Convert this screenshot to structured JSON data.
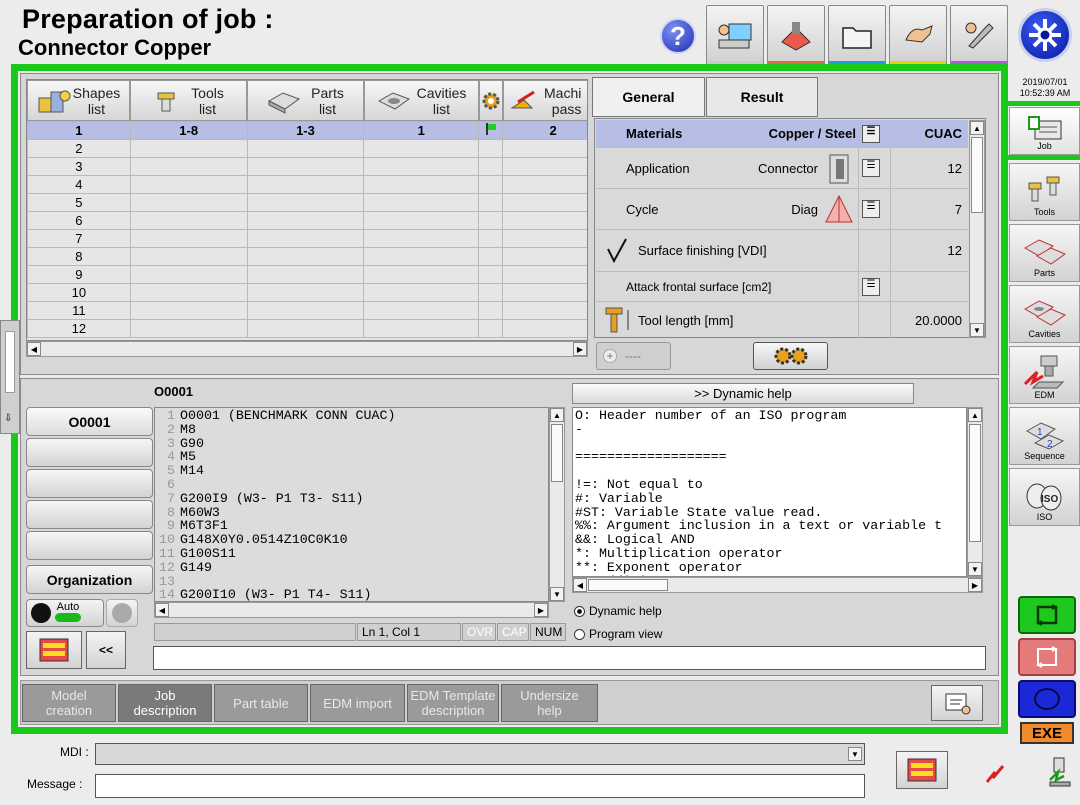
{
  "header": {
    "title": "Preparation of job :",
    "subtitle": "Connector Copper"
  },
  "clock": {
    "date": "2019/07/01",
    "time": "10:52:39 AM"
  },
  "top_toolbar": {
    "bar_colors": [
      "#c8c8c8",
      "#e06a3a",
      "#1e9be0",
      "#e8d400",
      "#b05ad8"
    ]
  },
  "table": {
    "headers": [
      {
        "line1": "Shapes",
        "line2": "list"
      },
      {
        "line1": "Tools",
        "line2": "list"
      },
      {
        "line1": "Parts",
        "line2": "list"
      },
      {
        "line1": "Cavities",
        "line2": "list"
      },
      {
        "line1": "Machi",
        "line2": "pass"
      }
    ],
    "first_row": {
      "shapes": "1",
      "tools": "1-8",
      "parts": "1-3",
      "cavities": "1",
      "pass": "2"
    },
    "row_numbers": [
      "2",
      "3",
      "4",
      "5",
      "6",
      "7",
      "8",
      "9",
      "10",
      "11",
      "12"
    ]
  },
  "right_tabs": {
    "general": "General",
    "result": "Result"
  },
  "properties": {
    "materials": {
      "label": "Materials",
      "value": "Copper / Steel",
      "code": "CUAC"
    },
    "application": {
      "label": "Application",
      "value": "Connector",
      "num": "12"
    },
    "cycle": {
      "label": "Cycle",
      "value": "Diag",
      "num": "7"
    },
    "surface": {
      "label": "Surface finishing [VDI]",
      "num": "12"
    },
    "attack": {
      "label": "Attack frontal surface  [cm2]"
    },
    "tool_length": {
      "label": "Tool length [mm]",
      "num": "20.0000"
    }
  },
  "add_control": {
    "label": "----"
  },
  "program": {
    "name_header": "O0001",
    "left_button": "O0001",
    "organization": "Organization",
    "auto": "Auto",
    "collapse": "<<",
    "lines": [
      {
        "n": "1",
        "t": "O0001 (BENCHMARK CONN CUAC)"
      },
      {
        "n": "2",
        "t": "M8"
      },
      {
        "n": "3",
        "t": "G90"
      },
      {
        "n": "4",
        "t": "M5"
      },
      {
        "n": "5",
        "t": "M14"
      },
      {
        "n": "6",
        "t": ""
      },
      {
        "n": "7",
        "t": "G200I9 (W3- P1 T3- S11)"
      },
      {
        "n": "8",
        "t": "M60W3"
      },
      {
        "n": "9",
        "t": "M6T3F1"
      },
      {
        "n": "10",
        "t": "G148X0Y0.0514Z10C0K10"
      },
      {
        "n": "11",
        "t": "G100S11"
      },
      {
        "n": "12",
        "t": "G149"
      },
      {
        "n": "13",
        "t": ""
      },
      {
        "n": "14",
        "t": "G200I10 (W3- P1 T4- S11)"
      }
    ],
    "status_pos": "Ln 1, Col 1",
    "status_ovr": "OVR",
    "status_cap": "CAP",
    "status_num": "NUM"
  },
  "dynamic_help": {
    "button": ">> Dynamic help",
    "lines": [
      "O: Header number of an ISO program",
      "-",
      "",
      "===================",
      "",
      "!=: Not equal to",
      "#: Variable",
      "#ST: Variable State value read.",
      "%%: Argument inclusion in a text or variable t",
      "&&: Logical AND",
      "*: Multiplication operator",
      "**: Exponent operator",
      "+: Addition"
    ],
    "radio_dynamic": "Dynamic help",
    "radio_program": "Program view"
  },
  "bottom_tabs": [
    {
      "l1": "Model",
      "l2": "creation"
    },
    {
      "l1": "Job",
      "l2": "description"
    },
    {
      "l1": "Part table",
      "l2": ""
    },
    {
      "l1": "EDM import",
      "l2": ""
    },
    {
      "l1": "EDM Template",
      "l2": "description"
    },
    {
      "l1": "Undersize",
      "l2": "help"
    }
  ],
  "sidebar": {
    "job": "Job",
    "tools": "Tools",
    "parts": "Parts",
    "cavities": "Cavities",
    "edm": "EDM",
    "sequence": "Sequence",
    "iso": "ISO"
  },
  "exe": "EXE",
  "mdi": {
    "label": "MDI :"
  },
  "message": {
    "label": "Message :"
  }
}
